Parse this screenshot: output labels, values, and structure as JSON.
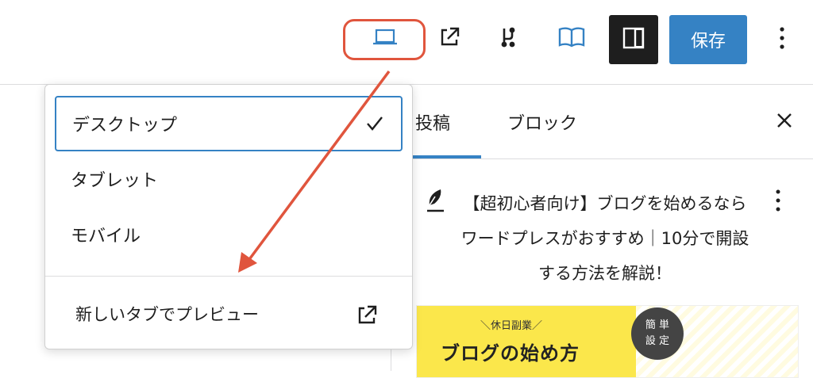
{
  "toolbar": {
    "preview_icon": "laptop-icon",
    "external_icon": "external-link-icon",
    "revisions_icon": "revisions-icon",
    "reader_icon": "book-icon",
    "sidebar_icon": "sidebar-toggle-icon",
    "save_label": "保存",
    "more_icon": "more-vertical-icon"
  },
  "preview_menu": {
    "items": [
      {
        "label": "デスクトップ",
        "selected": true
      },
      {
        "label": "タブレット",
        "selected": false
      },
      {
        "label": "モバイル",
        "selected": false
      }
    ],
    "new_tab_label": "新しいタブでプレビュー"
  },
  "sidebar": {
    "tabs": [
      {
        "label": "投稿",
        "active": true
      },
      {
        "label": "ブロック",
        "active": false
      }
    ],
    "post_title": "【超初心者向け】ブログを始めるならワードプレスがおすすめ｜10分で開設する方法を解説！",
    "featured_image": {
      "subtitle": "＼休日副業／",
      "title": "ブログの始め方",
      "badge_line1": "簡 単",
      "badge_line2": "設 定"
    }
  },
  "colors": {
    "accent": "#3582c4",
    "annotation": "#e0553d",
    "dark": "#1e1e1e",
    "thumb_yellow": "#fbe74b"
  }
}
